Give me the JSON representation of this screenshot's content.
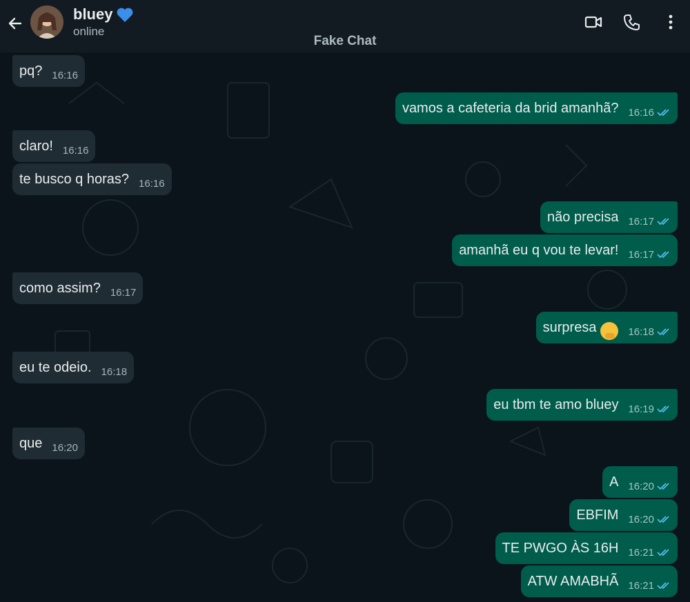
{
  "header": {
    "contact_name": "bluey",
    "status": "online",
    "watermark": "Fake Chat",
    "icons": [
      "back-arrow-icon",
      "blue-heart-icon",
      "video-call-icon",
      "phone-call-icon",
      "more-options-icon"
    ]
  },
  "colors": {
    "header_bg": "#111b21",
    "chat_bg": "#0b141a",
    "incoming_bubble": "#202c33",
    "outgoing_bubble": "#005c4b",
    "read_ticks": "#53bdeb",
    "heart": "#3b8eea"
  },
  "messages": [
    {
      "text": "pq?",
      "time": "16:16",
      "direction": "incoming"
    },
    {
      "text": "vamos a cafeteria da brid amanhã?",
      "time": "16:16",
      "direction": "outgoing",
      "status": "read"
    },
    {
      "text": "claro!",
      "time": "16:16",
      "direction": "incoming"
    },
    {
      "text": "te busco q horas?",
      "time": "16:16",
      "direction": "incoming"
    },
    {
      "text": "não precisa",
      "time": "16:17",
      "direction": "outgoing",
      "status": "read"
    },
    {
      "text": "amanhã eu q vou te levar!",
      "time": "16:17",
      "direction": "outgoing",
      "status": "read"
    },
    {
      "text": "como assim?",
      "time": "16:17",
      "direction": "incoming"
    },
    {
      "text": "surpresa",
      "emoji": "hand-over-mouth-emoji",
      "time": "16:18",
      "direction": "outgoing",
      "status": "read"
    },
    {
      "text": "eu te odeio.",
      "time": "16:18",
      "direction": "incoming"
    },
    {
      "text": "eu tbm te amo bluey",
      "time": "16:19",
      "direction": "outgoing",
      "status": "read"
    },
    {
      "text": "que",
      "time": "16:20",
      "direction": "incoming"
    },
    {
      "text": "A",
      "time": "16:20",
      "direction": "outgoing",
      "status": "read"
    },
    {
      "text": "EBFIM",
      "time": "16:20",
      "direction": "outgoing",
      "status": "read"
    },
    {
      "text": "TE PWGO ÀS 16H",
      "time": "16:21",
      "direction": "outgoing",
      "status": "read"
    },
    {
      "text": "ATW AMABHÃ",
      "time": "16:21",
      "direction": "outgoing",
      "status": "read"
    }
  ]
}
